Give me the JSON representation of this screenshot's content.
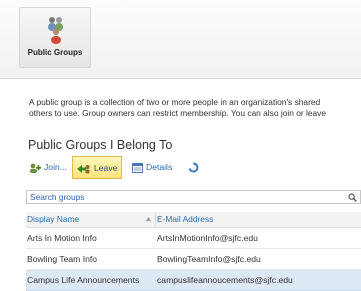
{
  "ribbon": {
    "public_groups_label": "Public Groups"
  },
  "description": {
    "line1": "A public group is a collection of two or more people in an organization's shared",
    "line2": "others to use. Group owners can restrict membership. You can also join or leave"
  },
  "section": {
    "title": "Public Groups I Belong To"
  },
  "toolbar": {
    "join_label": "Join...",
    "leave_label": "Leave",
    "details_label": "Details"
  },
  "search": {
    "placeholder": "Search groups"
  },
  "grid": {
    "columns": [
      "Display Name",
      "E-Mail Address"
    ],
    "rows": [
      {
        "name": "Arts In Motion Info",
        "email": "ArtsInMotionInfo@sjfc.edu"
      },
      {
        "name": "Bowling Team Info",
        "email": "BowlingTeamInfo@sjfc.edu"
      },
      {
        "name": "Campus Life Announcements",
        "email": "campuslifeannoucements@sjfc.edu"
      }
    ],
    "selected_row": 2
  },
  "colors": {
    "link_blue": "#2a6ab3",
    "selected_row": "#dde8f5",
    "leave_highlight": "#ffe27a"
  },
  "icons": {
    "public_groups": "people-group-icon",
    "join": "join-group-icon",
    "leave": "leave-group-icon",
    "details": "details-icon",
    "refresh": "refresh-icon",
    "search": "search-icon",
    "sort": "sort-arrow-icon"
  }
}
